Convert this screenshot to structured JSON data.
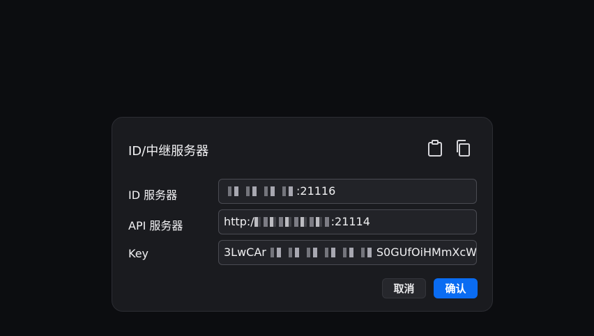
{
  "dialog": {
    "title": "ID/中继服务器",
    "icons": {
      "paste": "clipboard-paste-icon",
      "copy": "copy-icon"
    },
    "fields": [
      {
        "label": "ID 服务器",
        "value_visible_suffix": ":21116",
        "obscured": true
      },
      {
        "label": "API 服务器",
        "value_visible_prefix": "http:/",
        "value_visible_suffix": ":21114",
        "obscured": true
      },
      {
        "label": "Key",
        "value_visible_prefix": "3LwCAr",
        "value_visible_suffix": "S0GUfOiHMmXcW",
        "obscured": true
      }
    ],
    "cancel_label": "取消",
    "ok_label": "确认"
  },
  "colors": {
    "background": "#0c0d10",
    "dialog_bg": "#1a1b1f",
    "accent": "#0a6cf2"
  }
}
